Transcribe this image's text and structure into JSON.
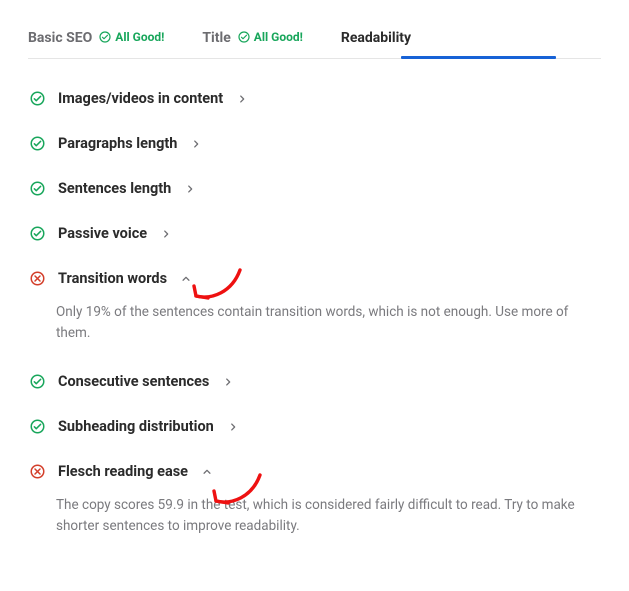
{
  "tabs": [
    {
      "label": "Basic SEO",
      "badge": "All Good!",
      "status": "pass",
      "active": false
    },
    {
      "label": "Title",
      "badge": "All Good!",
      "status": "pass",
      "active": false
    },
    {
      "label": "Readability",
      "badge": "",
      "status": "none",
      "active": true
    }
  ],
  "items": [
    {
      "status": "pass",
      "title": "Images/videos in content",
      "expanded": false,
      "body": ""
    },
    {
      "status": "pass",
      "title": "Paragraphs length",
      "expanded": false,
      "body": ""
    },
    {
      "status": "pass",
      "title": "Sentences length",
      "expanded": false,
      "body": ""
    },
    {
      "status": "pass",
      "title": "Passive voice",
      "expanded": false,
      "body": ""
    },
    {
      "status": "fail",
      "title": "Transition words",
      "expanded": true,
      "body": "Only 19% of the sentences contain transition words, which is not enough. Use more of them."
    },
    {
      "status": "pass",
      "title": "Consecutive sentences",
      "expanded": false,
      "body": ""
    },
    {
      "status": "pass",
      "title": "Subheading distribution",
      "expanded": false,
      "body": ""
    },
    {
      "status": "fail",
      "title": "Flesch reading ease",
      "expanded": true,
      "body": "The copy scores 59.9 in the test, which is considered fairly difficult to read. Try to make shorter sentences to improve readability."
    }
  ],
  "colors": {
    "pass": "#18a65b",
    "fail": "#d33e2a",
    "accent": "#1762d6"
  }
}
